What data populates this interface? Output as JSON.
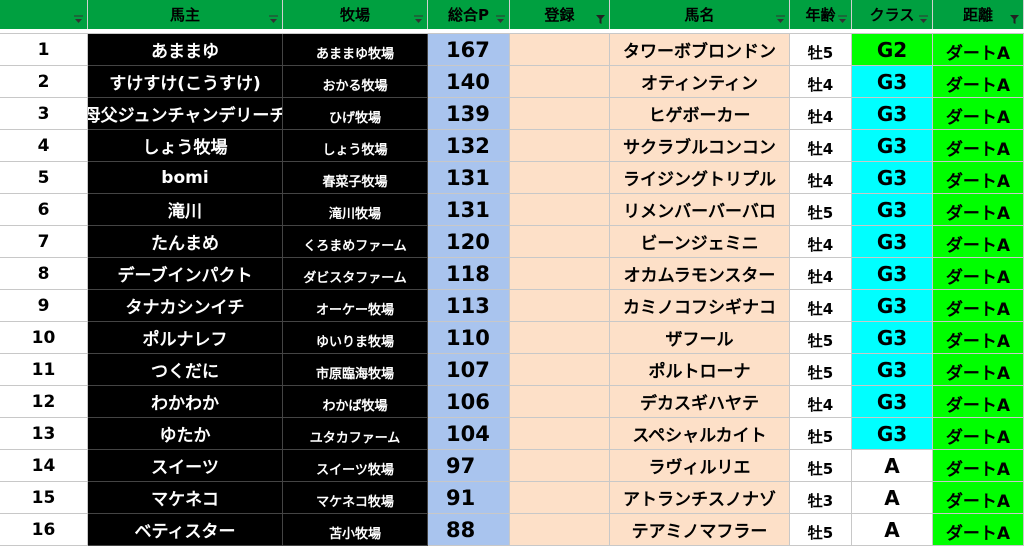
{
  "header": {
    "owner": "馬主",
    "farm": "牧場",
    "points": "総合P",
    "registration": "登録",
    "horse": "馬名",
    "age": "年齢",
    "class": "クラス",
    "distance": "距離"
  },
  "colors": {
    "header_green": "#00a040",
    "black_cell": "#000000",
    "points_blue": "#a9c4ee",
    "peach": "#fde0c8",
    "class_g2": "#00ff00",
    "class_g3": "#00ffff",
    "class_a": "#ffffff",
    "distance_green": "#00ff00"
  },
  "rows": [
    {
      "rank": "1",
      "owner": "あままゆ",
      "farm": "あままゆ牧場",
      "points": "167",
      "horse": "タワーボブロンドン",
      "age": "牡5",
      "class": "G2",
      "distance": "ダートA"
    },
    {
      "rank": "2",
      "owner": "すけすけ(こうすけ)",
      "farm": "おかる牧場",
      "points": "140",
      "horse": "オティンティン",
      "age": "牡4",
      "class": "G3",
      "distance": "ダートA"
    },
    {
      "rank": "3",
      "owner": "母父ジュンチャンデリーチ",
      "farm": "ひげ牧場",
      "points": "139",
      "horse": "ヒゲボーカー",
      "age": "牡4",
      "class": "G3",
      "distance": "ダートA"
    },
    {
      "rank": "4",
      "owner": "しょう牧場",
      "farm": "しょう牧場",
      "points": "132",
      "horse": "サクラブルコンコン",
      "age": "牡4",
      "class": "G3",
      "distance": "ダートA"
    },
    {
      "rank": "5",
      "owner": "bomi",
      "farm": "春菜子牧場",
      "points": "131",
      "horse": "ライジングトリプル",
      "age": "牡4",
      "class": "G3",
      "distance": "ダートA"
    },
    {
      "rank": "6",
      "owner": "滝川",
      "farm": "滝川牧場",
      "points": "131",
      "horse": "リメンバーバーバロ",
      "age": "牡5",
      "class": "G3",
      "distance": "ダートA"
    },
    {
      "rank": "7",
      "owner": "たんまめ",
      "farm": "くろまめファーム",
      "points": "120",
      "horse": "ビーンジェミニ",
      "age": "牡4",
      "class": "G3",
      "distance": "ダートA"
    },
    {
      "rank": "8",
      "owner": "デーブインパクト",
      "farm": "ダビスタファーム",
      "points": "118",
      "horse": "オカムラモンスター",
      "age": "牡4",
      "class": "G3",
      "distance": "ダートA"
    },
    {
      "rank": "9",
      "owner": "タナカシンイチ",
      "farm": "オーケー牧場",
      "points": "113",
      "horse": "カミノコフシギナコ",
      "age": "牡4",
      "class": "G3",
      "distance": "ダートA"
    },
    {
      "rank": "10",
      "owner": "ポルナレフ",
      "farm": "ゆいりま牧場",
      "points": "110",
      "horse": "ザフール",
      "age": "牡5",
      "class": "G3",
      "distance": "ダートA"
    },
    {
      "rank": "11",
      "owner": "つくだに",
      "farm": "市原臨海牧場",
      "points": "107",
      "horse": "ポルトローナ",
      "age": "牡5",
      "class": "G3",
      "distance": "ダートA"
    },
    {
      "rank": "12",
      "owner": "わかわか",
      "farm": "わかば牧場",
      "points": "106",
      "horse": "デカスギハヤテ",
      "age": "牡4",
      "class": "G3",
      "distance": "ダートA"
    },
    {
      "rank": "13",
      "owner": "ゆたか",
      "farm": "ユタカファーム",
      "points": "104",
      "horse": "スペシャルカイト",
      "age": "牡5",
      "class": "G3",
      "distance": "ダートA"
    },
    {
      "rank": "14",
      "owner": "スイーツ",
      "farm": "スイーツ牧場",
      "points": "97",
      "horse": "ラヴィルリエ",
      "age": "牡5",
      "class": "A",
      "distance": "ダートA"
    },
    {
      "rank": "15",
      "owner": "マケネコ",
      "farm": "マケネコ牧場",
      "points": "91",
      "horse": "アトランチスノナゾ",
      "age": "牡3",
      "class": "A",
      "distance": "ダートA"
    },
    {
      "rank": "16",
      "owner": "ベティスター",
      "farm": "苫小牧場",
      "points": "88",
      "horse": "テアミノマフラー",
      "age": "牡5",
      "class": "A",
      "distance": "ダートA"
    }
  ]
}
